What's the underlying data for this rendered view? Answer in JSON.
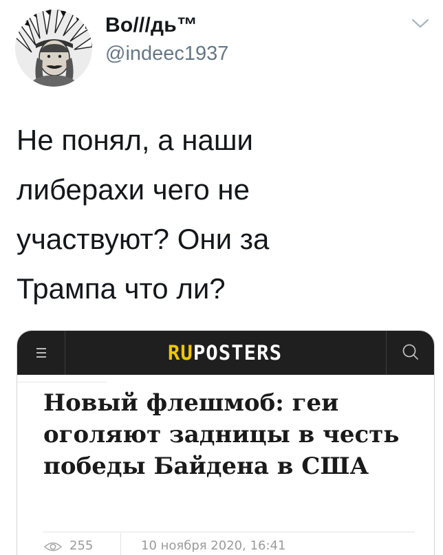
{
  "tweet": {
    "display_name": "Bo///дь™",
    "handle": "@indeec1937",
    "text": "Не понял, а наши\nлиберахи чего не\nучаствуют? Они за\nТрампа что ли?"
  },
  "embed": {
    "site_logo": "RUPOSTERS",
    "headline": "Новый флешмоб: геи оголяют задницы в честь победы Байдена в США",
    "views": "255",
    "date": "10 ноября 2020, 16:41"
  },
  "icons": {
    "tweet_menu": "chevron-down-icon",
    "site_menu": "hamburger-menu-icon",
    "site_search": "search-icon",
    "views": "eye-icon"
  },
  "colors": {
    "text_primary": "#14171a",
    "text_secondary": "#657786",
    "site_header_bg": "#1f1f1f",
    "logo_accent": "#f2c400",
    "logo_main": "#ffffff",
    "meta_text": "#9a9a9a"
  }
}
